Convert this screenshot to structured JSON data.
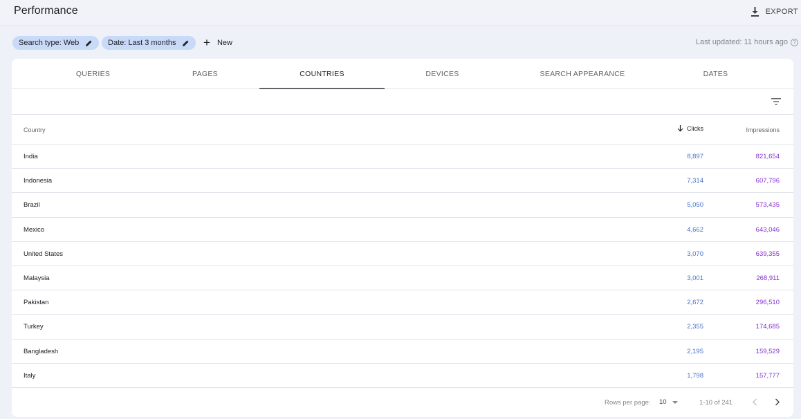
{
  "header": {
    "title": "Performance",
    "export_label": "EXPORT"
  },
  "filters": {
    "search_type": "Search type: Web",
    "date": "Date: Last 3 months",
    "new_label": "New",
    "last_updated": "Last updated: 11 hours ago"
  },
  "tabs": [
    {
      "label": "QUERIES",
      "active": false
    },
    {
      "label": "PAGES",
      "active": false
    },
    {
      "label": "COUNTRIES",
      "active": true
    },
    {
      "label": "DEVICES",
      "active": false
    },
    {
      "label": "SEARCH APPEARANCE",
      "active": false
    },
    {
      "label": "DATES",
      "active": false
    }
  ],
  "table": {
    "columns": {
      "country": "Country",
      "clicks": "Clicks",
      "impressions": "Impressions"
    },
    "sorted_by": "Clicks",
    "sort_direction": "descending",
    "rows": [
      {
        "country": "India",
        "clicks": "8,897",
        "impressions": "821,654"
      },
      {
        "country": "Indonesia",
        "clicks": "7,314",
        "impressions": "607,796"
      },
      {
        "country": "Brazil",
        "clicks": "5,050",
        "impressions": "573,435"
      },
      {
        "country": "Mexico",
        "clicks": "4,662",
        "impressions": "643,046"
      },
      {
        "country": "United States",
        "clicks": "3,070",
        "impressions": "639,355"
      },
      {
        "country": "Malaysia",
        "clicks": "3,001",
        "impressions": "268,911"
      },
      {
        "country": "Pakistan",
        "clicks": "2,672",
        "impressions": "296,510"
      },
      {
        "country": "Turkey",
        "clicks": "2,355",
        "impressions": "174,685"
      },
      {
        "country": "Bangladesh",
        "clicks": "2,195",
        "impressions": "159,529"
      },
      {
        "country": "Italy",
        "clicks": "1,798",
        "impressions": "157,777"
      }
    ]
  },
  "pagination": {
    "rows_per_page_label": "Rows per page:",
    "rows_per_page_value": "10",
    "range": "1-10 of 241"
  },
  "colors": {
    "clicks": "#4a72c9",
    "impressions": "#8430ce",
    "chip_bg": "#c8daf8"
  }
}
